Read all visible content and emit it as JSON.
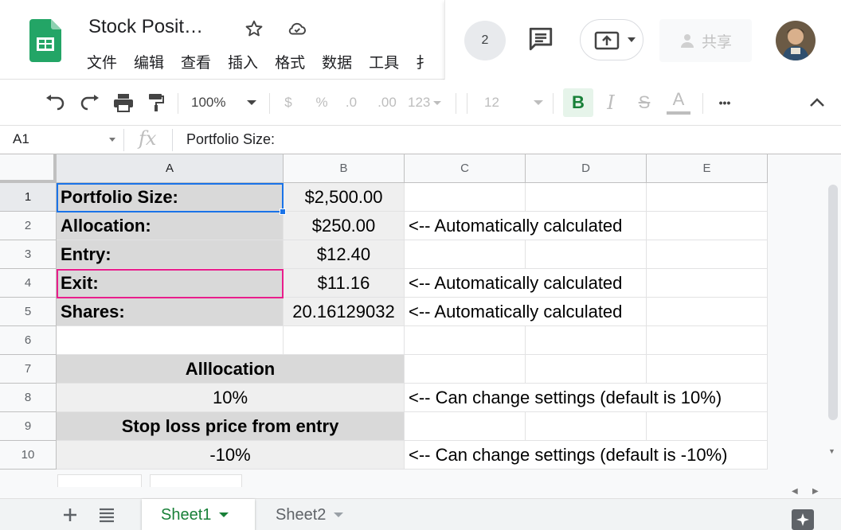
{
  "app": {
    "doc_title": "Stock Posit…",
    "menu": [
      "文件",
      "编辑",
      "查看",
      "插入",
      "格式",
      "数据",
      "工具",
      "扌"
    ],
    "collaborator_count": "2",
    "share_label": "共享",
    "icons": [
      "sheets-logo",
      "star-icon",
      "cloud-status-icon",
      "comment-icon",
      "present-icon",
      "share-lock-icon",
      "avatar"
    ]
  },
  "toolbar": {
    "zoom": "100%",
    "currency": "$",
    "percent": "%",
    "decrease_decimals": ".0",
    "increase_decimals": ".00",
    "more_formats": "123",
    "font_size": "12",
    "bold": "B",
    "italic": "I",
    "strikethrough": "S",
    "text_color": "A",
    "more": "•••"
  },
  "formula_bar": {
    "name_box": "A1",
    "fx": "fx",
    "content": "Portfolio Size:"
  },
  "columns": [
    "A",
    "B",
    "C",
    "D",
    "E"
  ],
  "rows": [
    "1",
    "2",
    "3",
    "4",
    "5",
    "6",
    "7",
    "8",
    "9",
    "10"
  ],
  "cells": {
    "a1": "Portfolio Size:",
    "b1": "$2,500.00",
    "a2": "Allocation:",
    "b2": "$250.00",
    "c2": "<-- Automatically calculated",
    "a3": "Entry:",
    "b3": "$12.40",
    "a4": "Exit:",
    "b4": "$11.16",
    "c4": "<-- Automatically calculated",
    "a5": "Shares:",
    "b5": "20.16129032",
    "c5": "<-- Automatically calculated",
    "a7": "Alllocation",
    "a8": "10%",
    "c8": "<-- Can change settings (default is 10%)",
    "a9": "Stop loss price from entry",
    "a10": "-10%",
    "c10": "<-- Can change settings (default is -10%)"
  },
  "sheets": {
    "tabs": [
      "Sheet1",
      "Sheet2"
    ],
    "active": "Sheet1"
  },
  "colors": {
    "selection": "#1a73e8",
    "highlight_border": "#e91e8c",
    "active_tab": "#188038",
    "label_fill": "#d9d9d9",
    "value_fill": "#efefef"
  }
}
